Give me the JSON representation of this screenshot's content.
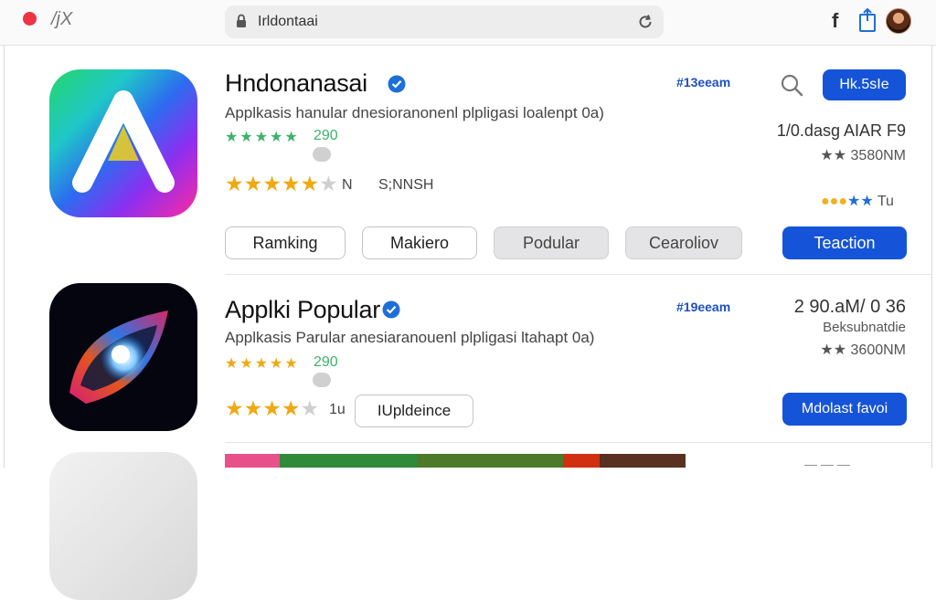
{
  "topbar": {
    "nav_glyph": "/jX",
    "url": "Irldontaai",
    "f_glyph": "f"
  },
  "apps": [
    {
      "title": "Hndonanasai",
      "description": "Applkasis hanular dnesioranonenl plpligasi loalenpt 0a)",
      "small_count": "290",
      "rating_extra": "N",
      "rating_code": "S;NNSH",
      "rank": "#13eeam",
      "action_label": "Hk.5sIe",
      "stat_line": "1/0.dasg AIAR F9",
      "stat_sub": "★★ 3580NM",
      "dots_suffix": "Tu",
      "buttons": [
        "Ramking",
        "Makiero",
        "Podular",
        "Cearoliov",
        "Teaction"
      ]
    },
    {
      "title": "Applki Popular",
      "description": "Applkasis Parular anesiaranouenl plpligasi ltahapt 0a)",
      "small_count": "290",
      "rating_extra": "1u",
      "rank": "#19eeam",
      "stat_line": "2 90.aM/ 0 36",
      "stat_sub_label": "Beksubnatdie",
      "stat_sub": "★★ 3600NM",
      "update_label": "IUpldeince",
      "action_label": "Mdolast favoi"
    }
  ],
  "colors": {
    "accent_blue": "#1554d8",
    "star_gold": "#f0a913",
    "star_green": "#3db36a",
    "close_red": "#ee3344"
  },
  "icons": [
    "lock-icon",
    "reload-icon",
    "share-icon",
    "search-icon",
    "verified-icon",
    "app-icon"
  ]
}
